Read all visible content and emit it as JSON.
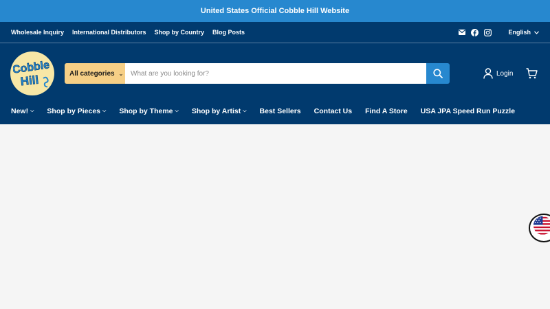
{
  "announcement": "United States Official Cobble Hill Website",
  "utility": {
    "links": [
      "Wholesale Inquiry",
      "International Distributors",
      "Shop by Country",
      "Blog Posts"
    ],
    "language": "English",
    "icons": [
      "email-icon",
      "facebook-icon",
      "instagram-icon"
    ]
  },
  "logo": {
    "line1": "Cobble",
    "line2": "Hill"
  },
  "search": {
    "category_label": "All categories",
    "placeholder": "What are you looking for?"
  },
  "account": {
    "login_label": "Login"
  },
  "nav": {
    "items": [
      "New!",
      "Shop by Pieces",
      "Shop by Theme",
      "Shop by Artist",
      "Best Sellers",
      "Contact Us",
      "Find A Store",
      "USA JPA Speed Run Puzzle"
    ]
  },
  "colors": {
    "announcement_bg": "#2788cf",
    "header_bg": "#013a6e",
    "category_bg": "#f6cf86",
    "search_button_bg": "#2788cf",
    "page_bg": "#f5f5f5",
    "logo_bg": "#f7e7a6"
  }
}
